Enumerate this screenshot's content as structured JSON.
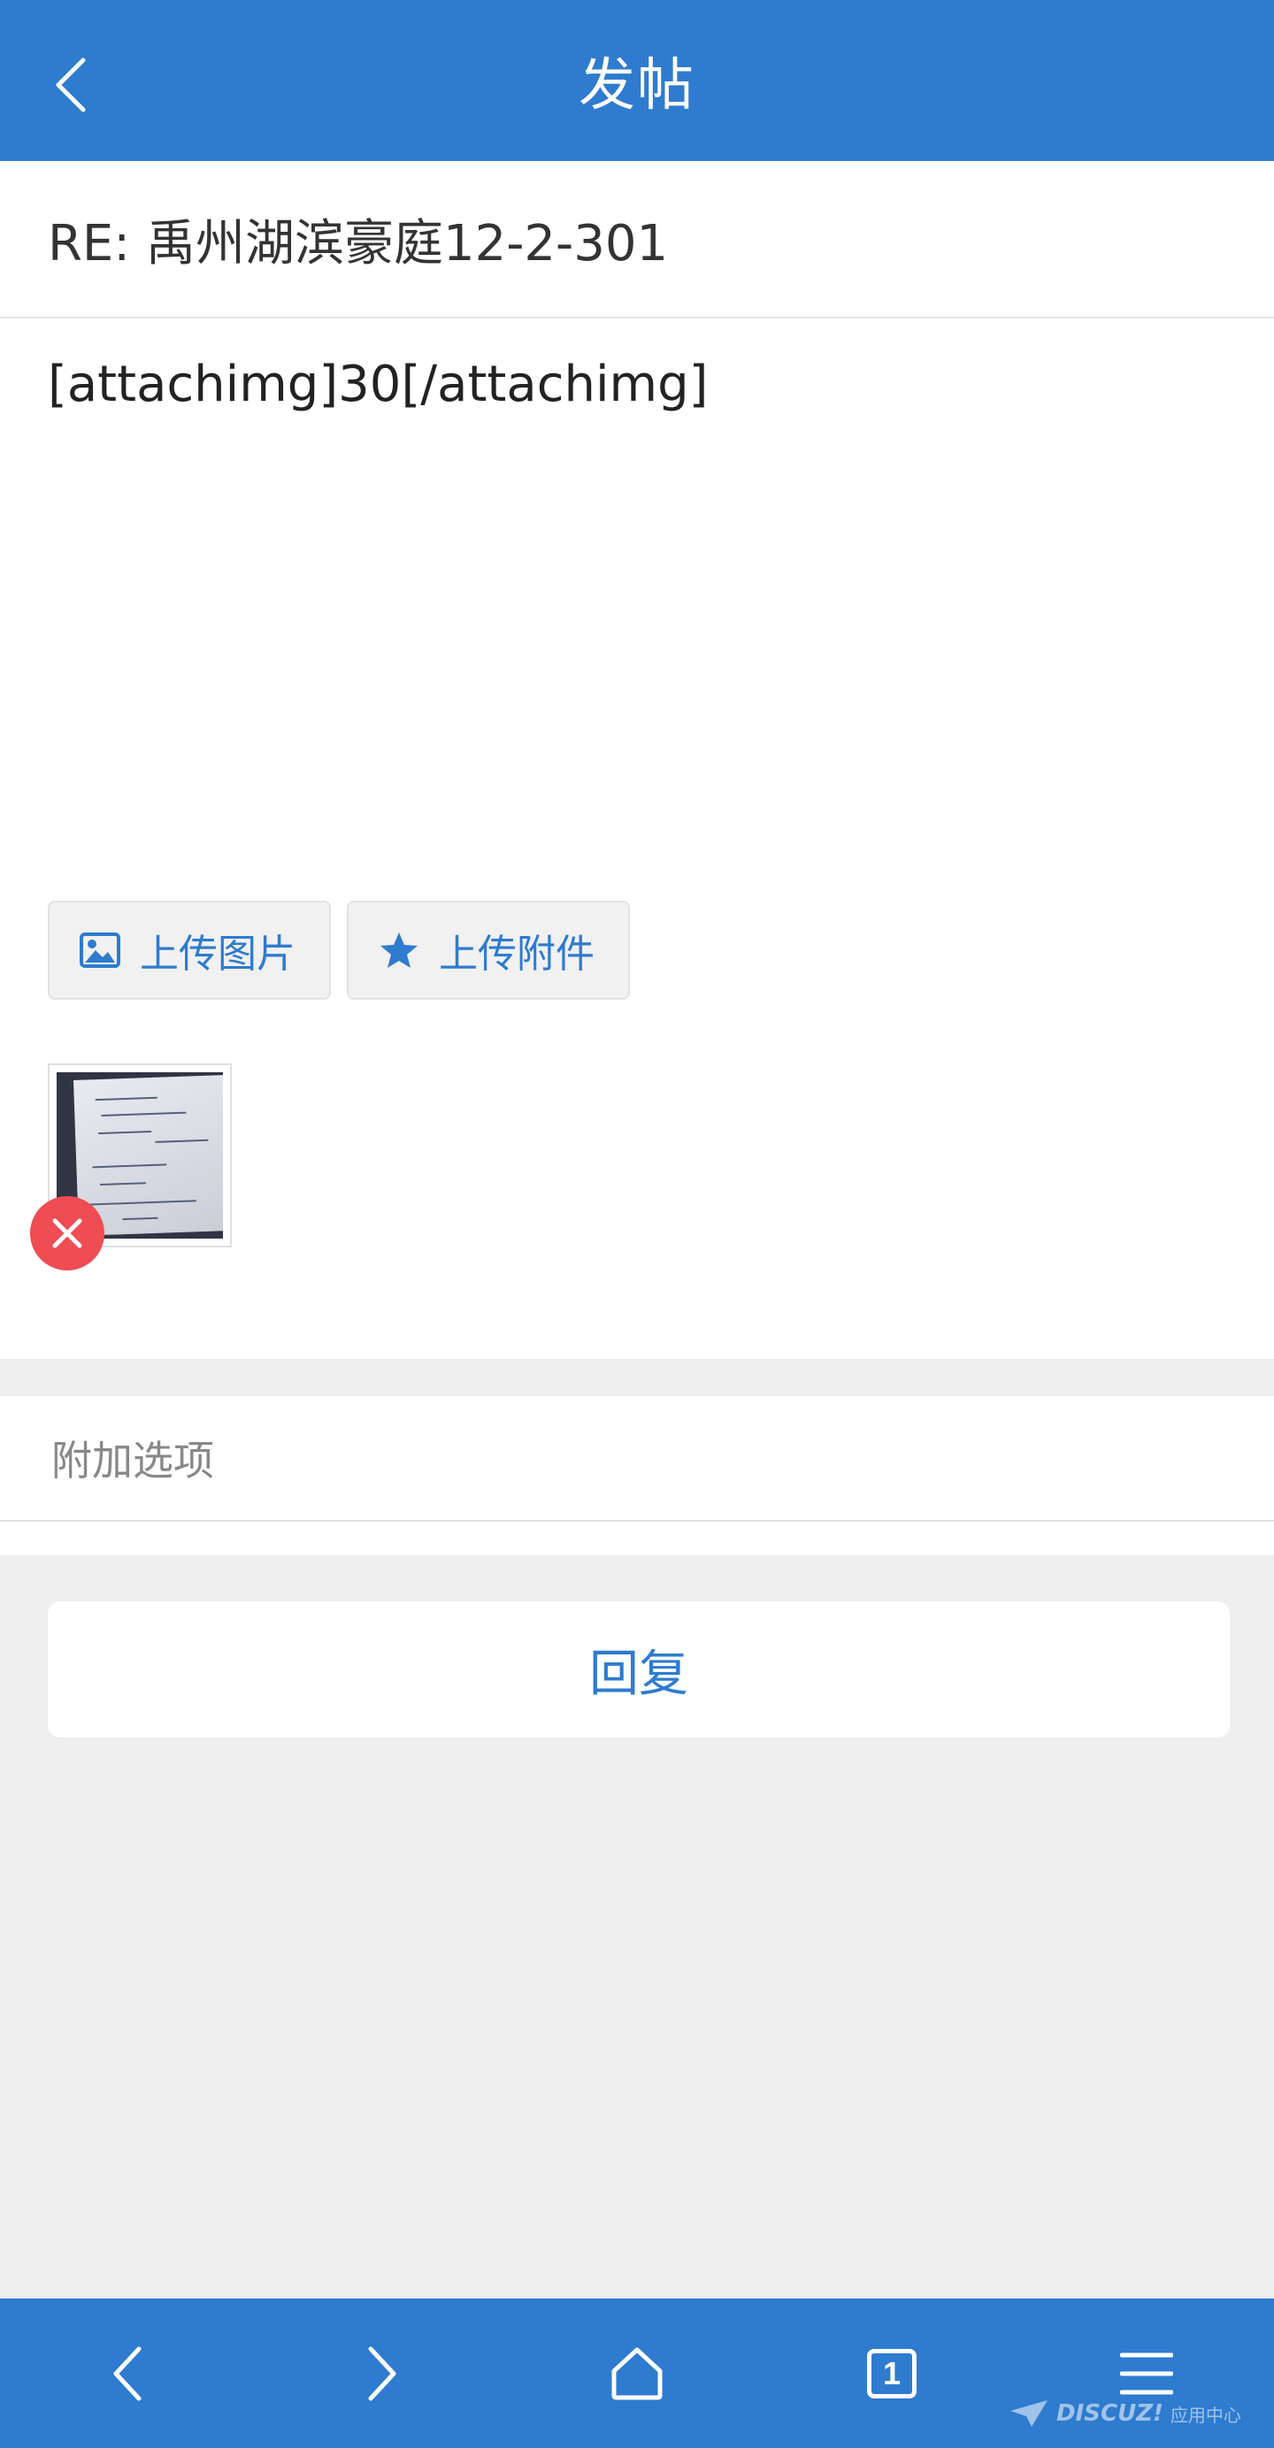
{
  "header": {
    "title": "发帖",
    "back_icon": "chevron-left-icon"
  },
  "compose": {
    "subject": "RE: 禹州湖滨豪庭12-2-301",
    "message": "[attachimg]30[/attachimg]",
    "upload_image_label": "上传图片",
    "upload_image_icon": "image-icon",
    "upload_attachment_label": "上传附件",
    "upload_attachment_icon": "star-icon",
    "attachment_thumbnail_icon": "photo-thumbnail",
    "delete_icon": "close-icon"
  },
  "options": {
    "label": "附加选项"
  },
  "reply": {
    "label": "回复"
  },
  "toolbar": {
    "back_icon": "chevron-left-icon",
    "forward_icon": "chevron-right-icon",
    "home_icon": "home-icon",
    "tab_count": "1",
    "menu_icon": "menu-icon"
  },
  "watermark": {
    "brand": "DISCUZ!",
    "sub": "应用中心"
  },
  "colors": {
    "primary": "#2e7bcf",
    "delete": "#f04c54",
    "background": "#eeeeee"
  }
}
